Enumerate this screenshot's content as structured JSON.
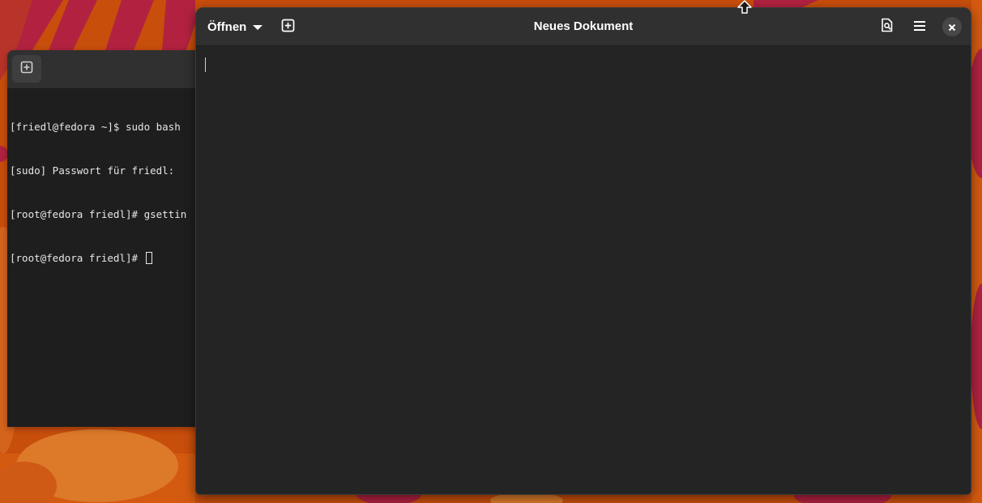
{
  "terminal": {
    "newtab_icon": "tab-new-icon",
    "lines": [
      "[friedl@fedora ~]$ sudo bash",
      "[sudo] Passwort für friedl:",
      "[root@fedora friedl]# gsettin",
      "[root@fedora friedl]# "
    ]
  },
  "editor": {
    "open_label": "Öffnen",
    "title": "Neues Dokument",
    "icons": {
      "open_menu": "chevron-down-icon",
      "new_document": "document-new-icon",
      "search": "document-search-icon",
      "menu": "hamburger-menu-icon",
      "close": "close-icon"
    },
    "content": ""
  },
  "colors": {
    "wallpaper_orange": "#c84e0c",
    "wallpaper_red": "#b22240",
    "window_bg": "#242424",
    "headerbar_bg": "#303030"
  }
}
